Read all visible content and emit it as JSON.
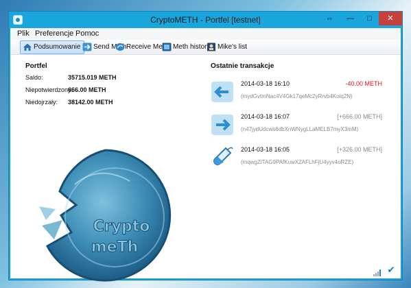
{
  "window": {
    "title": "CryptoMETH - Portfel [testnet]",
    "controls": {
      "resize": "⇔",
      "minimize": "—",
      "maximize": "□",
      "close": "✕"
    }
  },
  "menu": [
    "Plik",
    "Preferencje",
    "Pomoc"
  ],
  "toolbar": [
    {
      "label": "Podsumowanie",
      "icon": "home-icon",
      "active": true
    },
    {
      "label": "Send Meth",
      "icon": "send-arrow-icon",
      "active": false
    },
    {
      "label": "Receive Meth",
      "icon": "receive-icon",
      "active": false
    },
    {
      "label": "Meth history",
      "icon": "history-icon",
      "active": false
    },
    {
      "label": "Mike's list",
      "icon": "address-book-icon",
      "active": false
    }
  ],
  "wallet": {
    "heading": "Portfel",
    "rows": [
      {
        "label": "Saldo:",
        "value": "35715.019 METH"
      },
      {
        "label": "Niepotwierdzony:",
        "value": "666.00 METH"
      },
      {
        "label": "Niedojrzały:",
        "value": "38142.00 METH"
      }
    ]
  },
  "coin": {
    "line1": "Crypto",
    "line2": "meTh"
  },
  "recent": {
    "heading": "Ostatnie transakcje",
    "items": [
      {
        "date": "2014-03-18 16:10",
        "amount": "-40.00 METH",
        "address": "(mydGvtmNac4V4Gk17qeMc2yRrvb4Koiq2N)",
        "kind": "sent",
        "icon": "sent-arrow-icon"
      },
      {
        "date": "2014-03-18 16:07",
        "amount": "[+666.00 METH]",
        "address": "(n47jydUdcws6dbXnWNygLLaMELB7myX3mM)",
        "kind": "received",
        "icon": "received-arrow-icon"
      },
      {
        "date": "2014-03-18 16:05",
        "amount": "[+326.00 METH]",
        "address": "(mqwgZiTAG9PAfKuwX2AFLhFjU4yyv4oRZE)",
        "kind": "mined",
        "icon": "test-tube-icon"
      }
    ]
  },
  "colors": {
    "accent": "#1aa6dc",
    "negative": "#e01010",
    "muted": "#8a8a8a"
  }
}
